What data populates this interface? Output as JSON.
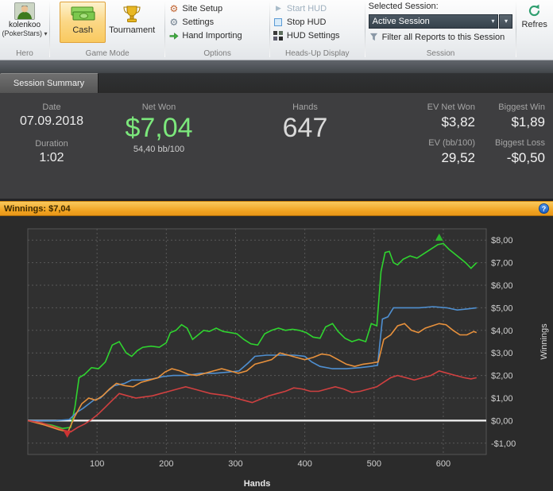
{
  "icons": {
    "caret_down": "▾",
    "gear": "⚙",
    "play": "▶"
  },
  "ribbon": {
    "hero": {
      "name": "kolenkoo",
      "site": "(PokerStars)",
      "label": "Hero"
    },
    "game_mode": {
      "cash": "Cash",
      "tournament": "Tournament",
      "label": "Game Mode"
    },
    "options": {
      "items": [
        "Site Setup",
        "Settings",
        "Hand Importing"
      ],
      "label": "Options"
    },
    "hud": {
      "items": [
        "Start HUD",
        "Stop HUD",
        "HUD Settings"
      ],
      "label": "Heads-Up Display"
    },
    "session": {
      "selected_label": "Selected Session:",
      "dropdown_value": "Active Session",
      "filter_label": "Filter all Reports to this Session",
      "label": "Session"
    },
    "refresh_label": "Refres"
  },
  "tabs": [
    {
      "label": "Session Summary"
    }
  ],
  "summary": {
    "date_label": "Date",
    "date": "07.09.2018",
    "duration_label": "Duration",
    "duration": "1:02",
    "net_won_label": "Net Won",
    "net_won": "$7,04",
    "bb100": "54,40 bb/100",
    "hands_label": "Hands",
    "hands": "647",
    "ev_net_won_label": "EV Net Won",
    "ev_net_won": "$3,82",
    "ev_bb_label": "EV (bb/100)",
    "ev_bb": "29,52",
    "biggest_win_label": "Biggest Win",
    "biggest_win": "$1,89",
    "biggest_loss_label": "Biggest Loss",
    "biggest_loss": "-$0,50"
  },
  "winnings_bar": {
    "label": "Winnings: $7,04",
    "help": "?"
  },
  "chart_data": {
    "type": "line",
    "title": "Winnings: $7,04",
    "xlabel": "Hands",
    "ylabel": "Winnings",
    "xlim": [
      0,
      662
    ],
    "ylim": [
      -1.5,
      8.5
    ],
    "grid": true,
    "legend": false,
    "x_ticks": [
      100,
      200,
      300,
      400,
      500,
      600
    ],
    "y_tick_values": [
      8,
      7,
      6,
      5,
      4,
      3,
      2,
      1,
      0,
      -1
    ],
    "y_ticks": [
      "$8,00",
      "$7,00",
      "$6,00",
      "$5,00",
      "$4,00",
      "$3,00",
      "$2,00",
      "$1,00",
      "$0,00",
      "-$1,00"
    ],
    "series": [
      {
        "name": "green-line",
        "color": "#2fd42f",
        "points": [
          [
            0,
            0
          ],
          [
            15,
            -0.1
          ],
          [
            35,
            -0.2
          ],
          [
            50,
            -0.35
          ],
          [
            62,
            -0.3
          ],
          [
            68,
            0.6
          ],
          [
            74,
            1.9
          ],
          [
            82,
            2.05
          ],
          [
            92,
            2.35
          ],
          [
            102,
            2.3
          ],
          [
            112,
            2.6
          ],
          [
            122,
            3.35
          ],
          [
            132,
            3.5
          ],
          [
            142,
            3.0
          ],
          [
            150,
            2.85
          ],
          [
            158,
            3.1
          ],
          [
            166,
            3.25
          ],
          [
            178,
            3.3
          ],
          [
            190,
            3.25
          ],
          [
            200,
            3.45
          ],
          [
            206,
            3.9
          ],
          [
            214,
            4.0
          ],
          [
            222,
            4.25
          ],
          [
            230,
            4.1
          ],
          [
            238,
            3.6
          ],
          [
            246,
            3.8
          ],
          [
            254,
            4.0
          ],
          [
            262,
            3.95
          ],
          [
            272,
            4.1
          ],
          [
            282,
            3.95
          ],
          [
            292,
            3.9
          ],
          [
            302,
            3.85
          ],
          [
            312,
            3.6
          ],
          [
            322,
            3.4
          ],
          [
            332,
            3.35
          ],
          [
            342,
            3.85
          ],
          [
            352,
            4.0
          ],
          [
            362,
            4.1
          ],
          [
            372,
            4.0
          ],
          [
            382,
            4.05
          ],
          [
            392,
            4.0
          ],
          [
            402,
            3.9
          ],
          [
            412,
            3.7
          ],
          [
            422,
            3.65
          ],
          [
            430,
            4.15
          ],
          [
            440,
            4.3
          ],
          [
            448,
            3.95
          ],
          [
            458,
            3.65
          ],
          [
            468,
            3.5
          ],
          [
            478,
            3.6
          ],
          [
            488,
            3.5
          ],
          [
            496,
            4.3
          ],
          [
            504,
            4.2
          ],
          [
            510,
            6.6
          ],
          [
            516,
            7.45
          ],
          [
            522,
            7.5
          ],
          [
            528,
            7.0
          ],
          [
            534,
            6.9
          ],
          [
            542,
            7.15
          ],
          [
            552,
            7.3
          ],
          [
            562,
            7.2
          ],
          [
            572,
            7.4
          ],
          [
            582,
            7.6
          ],
          [
            592,
            7.8
          ],
          [
            600,
            7.85
          ],
          [
            608,
            7.6
          ],
          [
            616,
            7.4
          ],
          [
            624,
            7.2
          ],
          [
            632,
            7.0
          ],
          [
            640,
            6.75
          ],
          [
            648,
            7.0
          ]
        ]
      },
      {
        "name": "blue-line",
        "color": "#4f8fd0",
        "points": [
          [
            0,
            0
          ],
          [
            40,
            0
          ],
          [
            60,
            0.05
          ],
          [
            70,
            0.35
          ],
          [
            80,
            0.55
          ],
          [
            95,
            0.9
          ],
          [
            105,
            1.0
          ],
          [
            115,
            1.3
          ],
          [
            125,
            1.55
          ],
          [
            140,
            1.65
          ],
          [
            150,
            1.8
          ],
          [
            165,
            1.8
          ],
          [
            180,
            1.85
          ],
          [
            195,
            1.95
          ],
          [
            210,
            2.0
          ],
          [
            230,
            2.0
          ],
          [
            250,
            2.1
          ],
          [
            270,
            2.1
          ],
          [
            290,
            2.15
          ],
          [
            305,
            2.2
          ],
          [
            318,
            2.55
          ],
          [
            328,
            2.85
          ],
          [
            345,
            2.9
          ],
          [
            365,
            2.9
          ],
          [
            385,
            2.9
          ],
          [
            400,
            2.85
          ],
          [
            410,
            2.6
          ],
          [
            422,
            2.4
          ],
          [
            440,
            2.3
          ],
          [
            460,
            2.3
          ],
          [
            480,
            2.35
          ],
          [
            495,
            2.4
          ],
          [
            505,
            2.45
          ],
          [
            512,
            4.5
          ],
          [
            520,
            4.6
          ],
          [
            528,
            5.0
          ],
          [
            545,
            5.0
          ],
          [
            565,
            5.0
          ],
          [
            585,
            5.05
          ],
          [
            605,
            5.0
          ],
          [
            620,
            4.9
          ],
          [
            635,
            4.95
          ],
          [
            648,
            5.0
          ]
        ]
      },
      {
        "name": "orange-line",
        "color": "#e8913c",
        "points": [
          [
            0,
            0
          ],
          [
            25,
            -0.2
          ],
          [
            45,
            -0.4
          ],
          [
            58,
            -0.5
          ],
          [
            68,
            0.2
          ],
          [
            78,
            0.75
          ],
          [
            88,
            1.0
          ],
          [
            98,
            0.9
          ],
          [
            108,
            1.1
          ],
          [
            118,
            1.4
          ],
          [
            128,
            1.65
          ],
          [
            140,
            1.55
          ],
          [
            152,
            1.5
          ],
          [
            164,
            1.7
          ],
          [
            176,
            1.8
          ],
          [
            188,
            1.9
          ],
          [
            198,
            2.15
          ],
          [
            208,
            2.3
          ],
          [
            220,
            2.2
          ],
          [
            232,
            2.05
          ],
          [
            244,
            2.0
          ],
          [
            256,
            2.1
          ],
          [
            268,
            2.2
          ],
          [
            280,
            2.3
          ],
          [
            292,
            2.2
          ],
          [
            304,
            2.1
          ],
          [
            316,
            2.2
          ],
          [
            328,
            2.5
          ],
          [
            340,
            2.6
          ],
          [
            352,
            2.7
          ],
          [
            364,
            3.0
          ],
          [
            376,
            2.9
          ],
          [
            388,
            2.8
          ],
          [
            400,
            2.7
          ],
          [
            412,
            2.8
          ],
          [
            424,
            2.95
          ],
          [
            436,
            2.9
          ],
          [
            448,
            2.7
          ],
          [
            460,
            2.5
          ],
          [
            472,
            2.4
          ],
          [
            484,
            2.5
          ],
          [
            496,
            2.55
          ],
          [
            506,
            2.6
          ],
          [
            514,
            3.6
          ],
          [
            524,
            3.8
          ],
          [
            534,
            4.2
          ],
          [
            544,
            4.3
          ],
          [
            554,
            4.0
          ],
          [
            564,
            3.9
          ],
          [
            574,
            4.1
          ],
          [
            584,
            4.2
          ],
          [
            594,
            4.3
          ],
          [
            604,
            4.25
          ],
          [
            614,
            4.0
          ],
          [
            624,
            3.8
          ],
          [
            634,
            3.8
          ],
          [
            644,
            3.95
          ],
          [
            648,
            3.9
          ]
        ]
      },
      {
        "name": "red-line",
        "color": "#d04040",
        "points": [
          [
            0,
            0
          ],
          [
            20,
            -0.1
          ],
          [
            40,
            -0.3
          ],
          [
            55,
            -0.45
          ],
          [
            62,
            -0.5
          ],
          [
            72,
            -0.3
          ],
          [
            82,
            -0.15
          ],
          [
            92,
            0.05
          ],
          [
            102,
            0.3
          ],
          [
            112,
            0.6
          ],
          [
            122,
            0.9
          ],
          [
            132,
            1.2
          ],
          [
            144,
            1.1
          ],
          [
            156,
            1.0
          ],
          [
            168,
            1.05
          ],
          [
            180,
            1.1
          ],
          [
            192,
            1.2
          ],
          [
            204,
            1.3
          ],
          [
            216,
            1.4
          ],
          [
            228,
            1.5
          ],
          [
            240,
            1.4
          ],
          [
            252,
            1.3
          ],
          [
            264,
            1.2
          ],
          [
            276,
            1.15
          ],
          [
            288,
            1.1
          ],
          [
            300,
            1.0
          ],
          [
            312,
            0.9
          ],
          [
            324,
            0.8
          ],
          [
            336,
            0.95
          ],
          [
            348,
            1.1
          ],
          [
            360,
            1.2
          ],
          [
            372,
            1.3
          ],
          [
            384,
            1.45
          ],
          [
            396,
            1.4
          ],
          [
            408,
            1.3
          ],
          [
            420,
            1.3
          ],
          [
            432,
            1.4
          ],
          [
            444,
            1.5
          ],
          [
            456,
            1.4
          ],
          [
            468,
            1.25
          ],
          [
            480,
            1.3
          ],
          [
            492,
            1.4
          ],
          [
            504,
            1.5
          ],
          [
            514,
            1.7
          ],
          [
            524,
            1.9
          ],
          [
            534,
            2.0
          ],
          [
            546,
            1.9
          ],
          [
            558,
            1.8
          ],
          [
            570,
            1.9
          ],
          [
            582,
            2.0
          ],
          [
            594,
            2.2
          ],
          [
            606,
            2.1
          ],
          [
            618,
            2.0
          ],
          [
            630,
            1.9
          ],
          [
            640,
            1.85
          ],
          [
            648,
            1.9
          ]
        ]
      }
    ],
    "markers": [
      {
        "shape": "triangle-up",
        "color": "#2db52d",
        "x": 594,
        "y": 8.15
      },
      {
        "shape": "triangle-down",
        "color": "#cc3333",
        "x": 57,
        "y": -0.62
      }
    ]
  }
}
